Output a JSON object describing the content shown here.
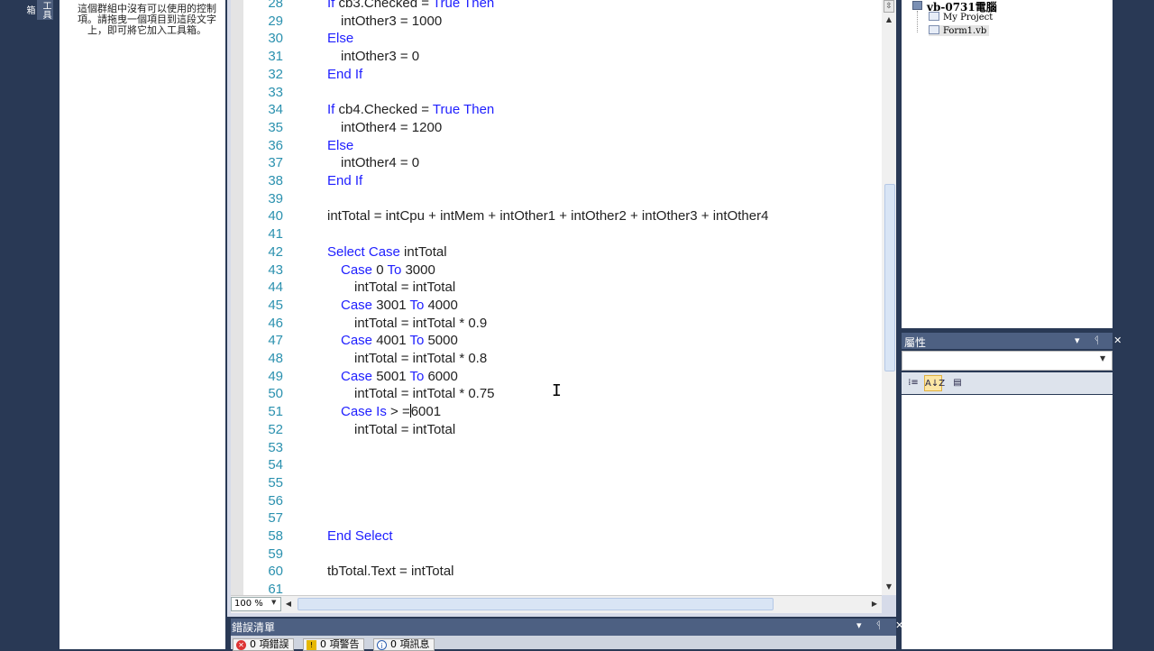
{
  "toolbox": {
    "tab_label": "工具箱",
    "empty_message": "這個群組中沒有可以使用的控制項。請拖曳一個項目到這段文字上，即可將它加入工具箱。"
  },
  "editor": {
    "lines": [
      {
        "n": "28",
        "indent": 0,
        "parts": [
          [
            "kw",
            "If "
          ],
          [
            "t",
            "cb3.Checked = "
          ],
          [
            "kw",
            "True Then"
          ]
        ]
      },
      {
        "n": "29",
        "indent": 1,
        "parts": [
          [
            "t",
            "intOther3 = 1000"
          ]
        ]
      },
      {
        "n": "30",
        "indent": 0,
        "parts": [
          [
            "kw",
            "Else"
          ]
        ]
      },
      {
        "n": "31",
        "indent": 1,
        "parts": [
          [
            "t",
            "intOther3 = 0"
          ]
        ]
      },
      {
        "n": "32",
        "indent": 0,
        "parts": [
          [
            "kw",
            "End If"
          ]
        ]
      },
      {
        "n": "33",
        "indent": 0,
        "parts": []
      },
      {
        "n": "34",
        "indent": 0,
        "parts": [
          [
            "kw",
            "If "
          ],
          [
            "t",
            "cb4.Checked = "
          ],
          [
            "kw",
            "True Then"
          ]
        ]
      },
      {
        "n": "35",
        "indent": 1,
        "parts": [
          [
            "t",
            "intOther4 = 1200"
          ]
        ]
      },
      {
        "n": "36",
        "indent": 0,
        "parts": [
          [
            "kw",
            "Else"
          ]
        ]
      },
      {
        "n": "37",
        "indent": 1,
        "parts": [
          [
            "t",
            "intOther4 = 0"
          ]
        ]
      },
      {
        "n": "38",
        "indent": 0,
        "parts": [
          [
            "kw",
            "End If"
          ]
        ]
      },
      {
        "n": "39",
        "indent": 0,
        "parts": []
      },
      {
        "n": "40",
        "indent": 0,
        "parts": [
          [
            "t",
            "intTotal = intCpu + intMem + intOther1 + intOther2 + intOther3 + intOther4"
          ]
        ]
      },
      {
        "n": "41",
        "indent": 0,
        "parts": []
      },
      {
        "n": "42",
        "indent": 0,
        "parts": [
          [
            "kw",
            "Select Case "
          ],
          [
            "t",
            "intTotal"
          ]
        ]
      },
      {
        "n": "43",
        "indent": 1,
        "parts": [
          [
            "kw",
            "Case "
          ],
          [
            "t",
            "0 "
          ],
          [
            "kw",
            "To "
          ],
          [
            "t",
            "3000"
          ]
        ]
      },
      {
        "n": "44",
        "indent": 2,
        "parts": [
          [
            "t",
            "intTotal = intTotal"
          ]
        ]
      },
      {
        "n": "45",
        "indent": 1,
        "parts": [
          [
            "kw",
            "Case "
          ],
          [
            "t",
            "3001 "
          ],
          [
            "kw",
            "To "
          ],
          [
            "t",
            "4000"
          ]
        ]
      },
      {
        "n": "46",
        "indent": 2,
        "parts": [
          [
            "t",
            "intTotal = intTotal * 0.9"
          ]
        ]
      },
      {
        "n": "47",
        "indent": 1,
        "parts": [
          [
            "kw",
            "Case "
          ],
          [
            "t",
            "4001 "
          ],
          [
            "kw",
            "To "
          ],
          [
            "t",
            "5000"
          ]
        ]
      },
      {
        "n": "48",
        "indent": 2,
        "parts": [
          [
            "t",
            "intTotal = intTotal * 0.8"
          ]
        ]
      },
      {
        "n": "49",
        "indent": 1,
        "parts": [
          [
            "kw",
            "Case "
          ],
          [
            "t",
            "5001 "
          ],
          [
            "kw",
            "To "
          ],
          [
            "t",
            "6000"
          ]
        ]
      },
      {
        "n": "50",
        "indent": 2,
        "parts": [
          [
            "t",
            "intTotal = intTotal * 0.75"
          ]
        ]
      },
      {
        "n": "51",
        "indent": 1,
        "parts": [
          [
            "kw",
            "Case Is "
          ],
          [
            "t",
            "> ="
          ],
          [
            "caret",
            ""
          ],
          [
            "t",
            "6001"
          ]
        ]
      },
      {
        "n": "52",
        "indent": 2,
        "parts": [
          [
            "t",
            "intTotal = intTotal"
          ]
        ]
      },
      {
        "n": "53",
        "indent": 0,
        "parts": []
      },
      {
        "n": "54",
        "indent": 0,
        "parts": []
      },
      {
        "n": "55",
        "indent": 0,
        "parts": []
      },
      {
        "n": "56",
        "indent": 0,
        "parts": []
      },
      {
        "n": "57",
        "indent": 0,
        "parts": []
      },
      {
        "n": "58",
        "indent": 0,
        "parts": [
          [
            "kw",
            "End Select"
          ]
        ]
      },
      {
        "n": "59",
        "indent": 0,
        "parts": []
      },
      {
        "n": "60",
        "indent": 0,
        "parts": [
          [
            "t",
            "tbTotal.Text = intTotal"
          ]
        ]
      },
      {
        "n": "61",
        "indent": 0,
        "parts": []
      }
    ],
    "zoom_level": "100 %"
  },
  "error_list": {
    "title": "錯誤清單",
    "errors_label": "0 項錯誤",
    "warnings_label": "0 項警告",
    "messages_label": "0 項訊息",
    "controls": "▾ ᛩ ✕"
  },
  "solution_explorer": {
    "project_name": "vb-0731電腦",
    "items": [
      "My Project",
      "Form1.vb"
    ]
  },
  "properties": {
    "title": "屬性",
    "controls": "▾ ᛩ ✕",
    "categorized_icon": "⁞≡",
    "alphabetical_icon": "A↓Z",
    "pages_icon": "▤"
  },
  "colors": {
    "keyword": "#2020ff",
    "line_number": "#2b91af",
    "panel_header": "#4d6082",
    "ide_background": "#293955"
  }
}
